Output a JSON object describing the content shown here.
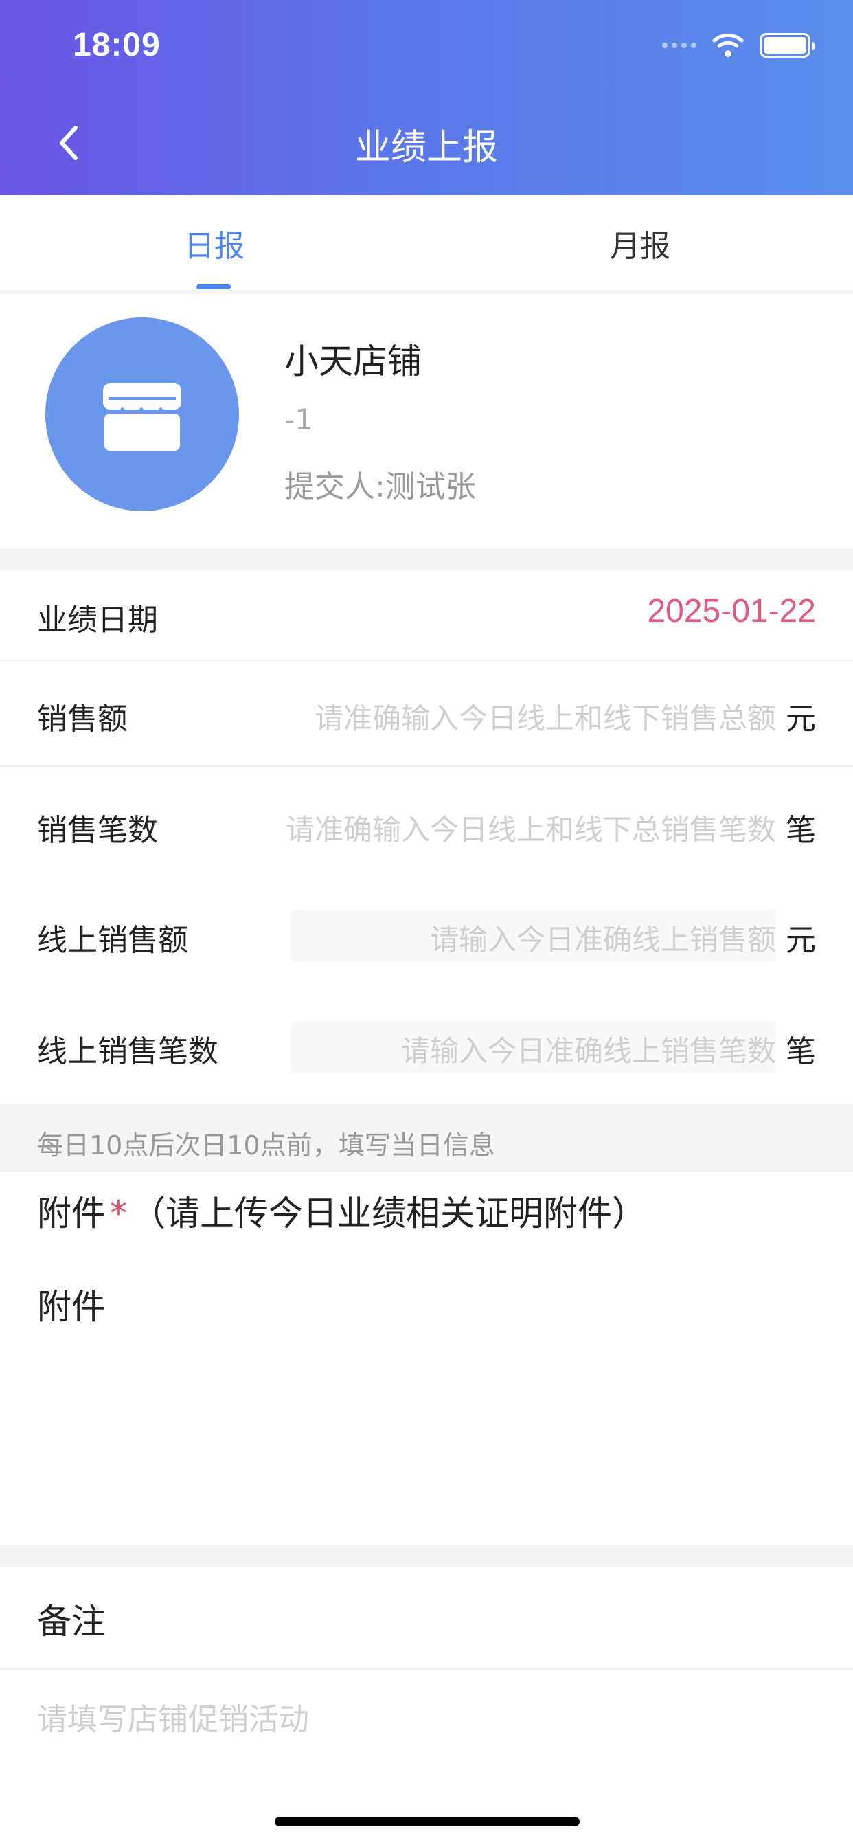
{
  "status_bar": {
    "time": "18:09"
  },
  "nav": {
    "title": "业绩上报"
  },
  "tabs": [
    {
      "label": "日报",
      "active": true
    },
    {
      "label": "月报",
      "active": false
    }
  ],
  "store": {
    "name": "小天店铺",
    "subtitle": "-1",
    "submitter": "提交人:测试张"
  },
  "form": {
    "date": {
      "label": "业绩日期",
      "value": "2025-01-22"
    },
    "sales_amount": {
      "label": "销售额",
      "placeholder": "请准确输入今日线上和线下销售总额",
      "unit": "元"
    },
    "sales_count": {
      "label": "销售笔数",
      "placeholder": "请准确输入今日线上和线下总销售笔数",
      "unit": "笔"
    },
    "online_amount": {
      "label": "线上销售额",
      "placeholder": "请输入今日准确线上销售额",
      "unit": "元"
    },
    "online_count": {
      "label": "线上销售笔数",
      "placeholder": "请输入今日准确线上销售笔数",
      "unit": "笔"
    }
  },
  "notice": "每日10点后次日10点前，填写当日信息",
  "attachment": {
    "title": "附件",
    "required_mark": "*",
    "hint": "（请上传今日业绩相关证明附件）",
    "label": "附件"
  },
  "remark": {
    "title": "备注",
    "placeholder": "请填写店铺促销活动"
  },
  "colors": {
    "accent": "#4a86f5",
    "date_value": "#e05a7c",
    "header_start": "#6b55e6",
    "header_end": "#5a8dea",
    "avatar": "#6a96ec"
  },
  "icons": {
    "back": "chevron-left-icon",
    "store": "store-icon",
    "wifi": "wifi-icon",
    "battery": "battery-icon",
    "signal": "signal-icon"
  }
}
